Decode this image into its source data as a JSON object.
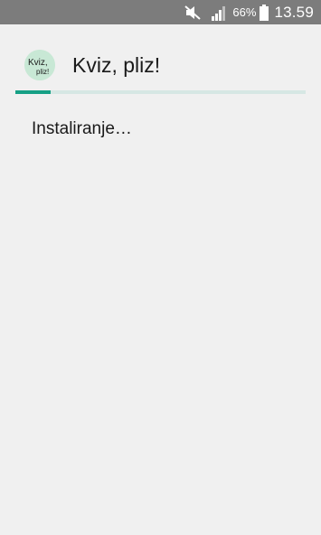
{
  "status_bar": {
    "battery_percent": "66%",
    "time": "13.59",
    "icons": [
      "mute-icon",
      "signal-icon",
      "battery-icon"
    ]
  },
  "header": {
    "title": "Kviz, pliz!",
    "logo": {
      "line1": "Kviz,",
      "line2": "pliz!",
      "icon": "app-logo-icon"
    }
  },
  "progress": {
    "value": 0.12,
    "color": "#16a085",
    "track_color": "#d6e7e4"
  },
  "main": {
    "status_text": "Instaliranje…"
  }
}
